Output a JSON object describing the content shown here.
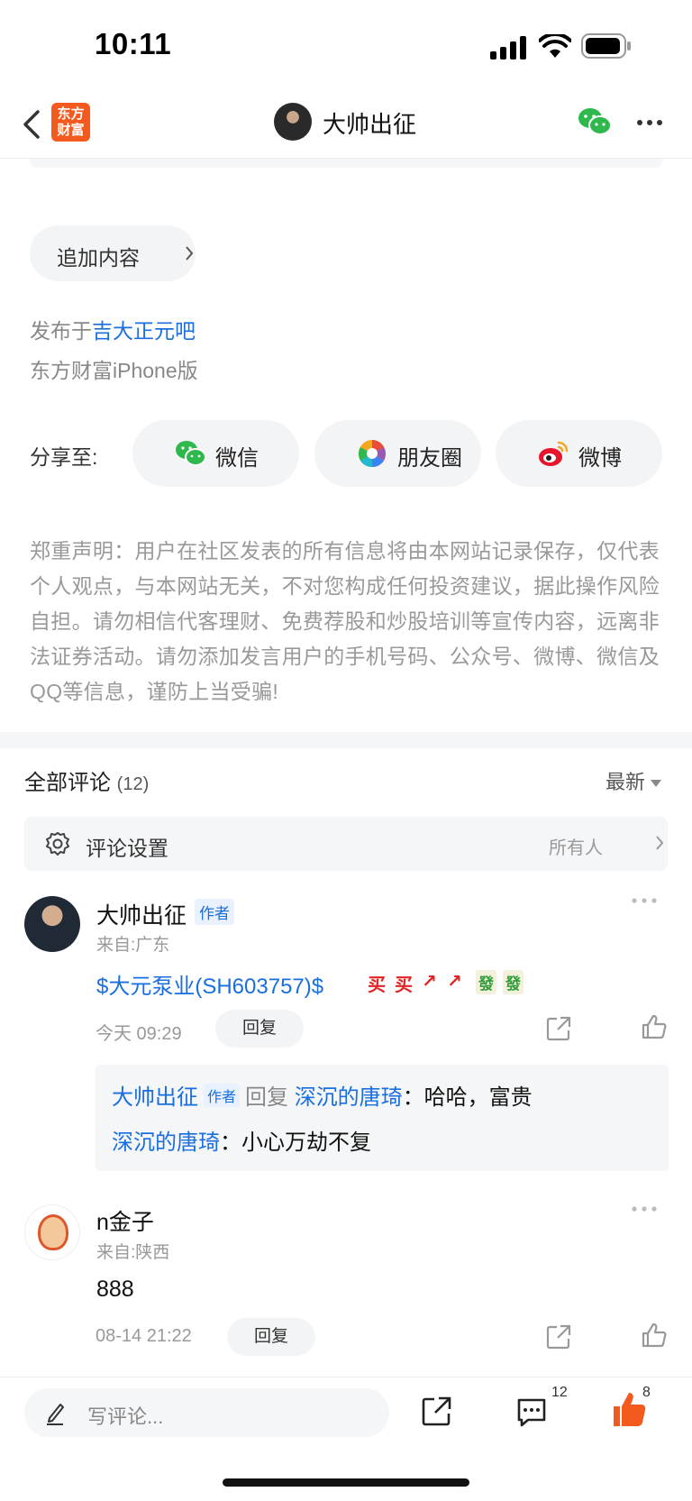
{
  "status": {
    "time": "10:11"
  },
  "header": {
    "logo_text_1": "东方",
    "logo_text_2": "财富",
    "title": "大帅出征"
  },
  "post": {
    "append_label": "追加内容",
    "published_prefix": "发布于",
    "published_bar": "吉大正元吧",
    "client": "东方财富iPhone版"
  },
  "share": {
    "label": "分享至:",
    "targets": [
      {
        "label": "微信",
        "icon": "wechat-icon"
      },
      {
        "label": "朋友圈",
        "icon": "moments-icon"
      },
      {
        "label": "微博",
        "icon": "weibo-icon"
      }
    ]
  },
  "disclaimer": "郑重声明：用户在社区发表的所有信息将由本网站记录保存，仅代表个人观点，与本网站无关，不对您构成任何投资建议，据此操作风险自担。请勿相信代客理财、免费荐股和炒股培训等宣传内容，远离非法证券活动。请勿添加发言用户的手机号码、公众号、微博、微信及QQ等信息，谨防上当受骗!",
  "comments_section": {
    "title": "全部评论",
    "count": "(12)",
    "sort": "最新",
    "settings_label": "评论设置",
    "settings_value": "所有人"
  },
  "comments": [
    {
      "name": "大帅出征",
      "badge": "作者",
      "from": "来自:广东",
      "text": "$大元泵业(SH603757)$",
      "emojis": [
        "买",
        "买",
        "↗",
        "↗",
        "發",
        "發"
      ],
      "time": "今天 09:29",
      "reply_label": "回复",
      "replies": {
        "l1_name": "大帅出征",
        "l1_badge": "作者",
        "l1_mid": "回复",
        "l1_target": "深沉的唐琦",
        "l1_text": "：哈哈，富贵",
        "l2_name": "深沉的唐琦",
        "l2_text": "：小心万劫不复"
      }
    },
    {
      "name": "n金子",
      "from": "来自:陕西",
      "text": "888",
      "time": "08-14 21:22",
      "reply_label": "回复"
    }
  ],
  "bottom": {
    "placeholder": "写评论...",
    "comment_count": "12",
    "like_count": "8"
  },
  "colors": {
    "accent": "#f45a1e",
    "link": "#1a6fe0",
    "muted": "#999999"
  }
}
